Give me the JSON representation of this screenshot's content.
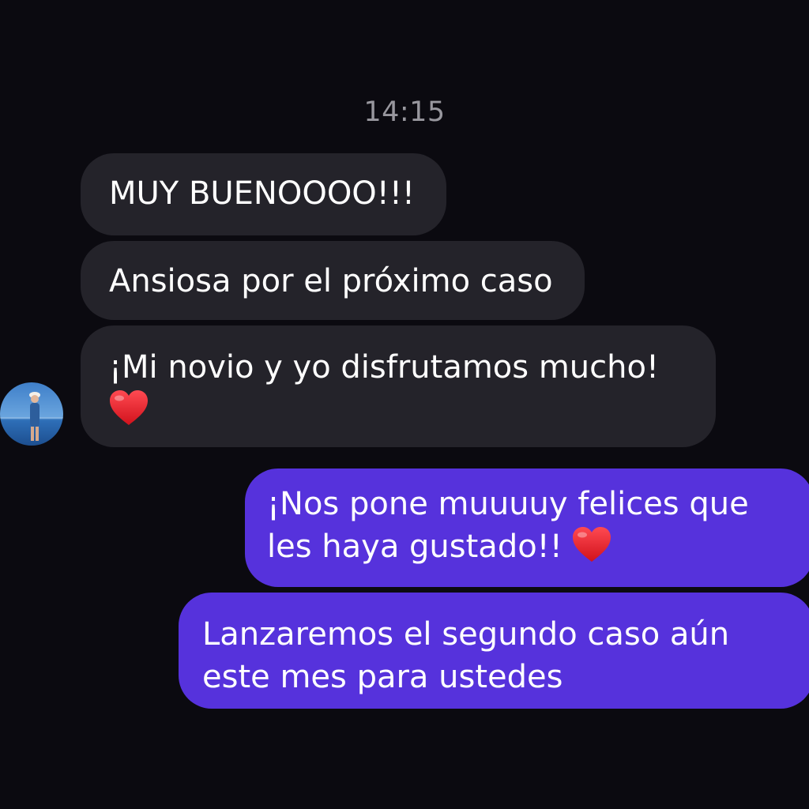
{
  "conversation": {
    "timestamp": "14:15",
    "incoming": [
      {
        "text": "MUY BUENOOOO!!!"
      },
      {
        "text": "Ansiosa por el próximo caso"
      },
      {
        "text": "¡Mi novio y yo disfrutamos mucho!",
        "icon": "heart-icon"
      }
    ],
    "outgoing": [
      {
        "text": "¡Nos pone muuuuy felices que les haya gustado!!",
        "icon": "heart-icon"
      },
      {
        "text": "Lanzaremos el segundo caso aún este mes para ustedes"
      }
    ]
  },
  "colors": {
    "background": "#0b0a10",
    "incoming_bubble": "#24232a",
    "outgoing_bubble": "#5632dc",
    "timestamp": "#98979e",
    "heart": "#e3212b"
  },
  "avatar": {
    "icon": "contact-avatar"
  }
}
